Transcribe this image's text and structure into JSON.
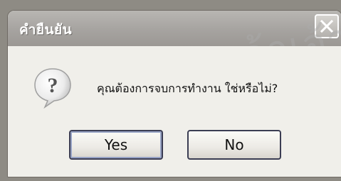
{
  "dialog": {
    "title": "คำยืนยัน",
    "message": "คุณต้องการจบการทำงาน ใช่หรือไม่?",
    "watermark": "จอมเกล้าเจ้าคุณ",
    "buttons": {
      "yes_label": "Yes",
      "no_label": "No"
    },
    "icons": {
      "prompt": "question-icon",
      "close": "close-icon"
    }
  }
}
